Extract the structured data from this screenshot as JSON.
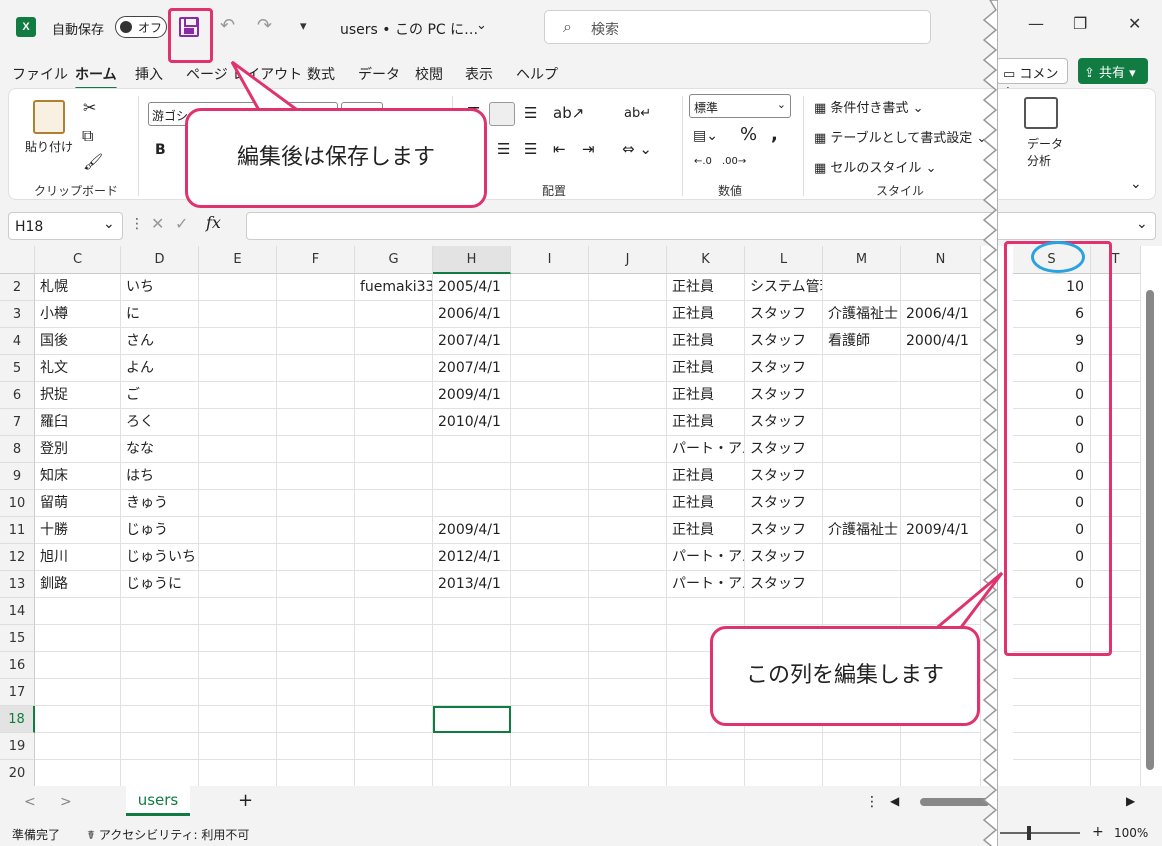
{
  "app": {
    "autosave_label": "自動保存",
    "autosave_state": "オフ",
    "doc_title": "users • この PC に…",
    "search_placeholder": "検索"
  },
  "ribbon_tabs": [
    "ファイル",
    "ホーム",
    "挿入",
    "ページ レイアウト",
    "数式",
    "データ",
    "校閲",
    "表示",
    "ヘルプ"
  ],
  "ribbon_right": {
    "comment": "コメント",
    "share": "共有"
  },
  "ribbon": {
    "paste": "貼り付け",
    "clipboard": "クリップボード",
    "font_name": "游ゴシック",
    "bold": "B",
    "alignment": "配置",
    "number_format": "標準",
    "number": "数値",
    "cond_format": "条件付き書式",
    "table_format": "テーブルとして書式設定",
    "cell_style": "セルのスタイル",
    "style": "スタイル",
    "data_analysis_1": "データ",
    "data_analysis_2": "分析"
  },
  "callouts": {
    "save": "編集後は保存します",
    "column": "この列を編集します"
  },
  "formula_bar": {
    "name_box": "H18",
    "fx": "fx"
  },
  "columns": [
    "C",
    "D",
    "E",
    "F",
    "G",
    "H",
    "I",
    "J",
    "K",
    "L",
    "M",
    "N",
    "S",
    "T"
  ],
  "rows": [
    {
      "n": "2",
      "C": "札幌",
      "D": "いち",
      "G": "fuemaki33",
      "H": "2005/4/1",
      "K": "正社員",
      "L": "システム管理者",
      "M": "",
      "N": "",
      "S": "10"
    },
    {
      "n": "3",
      "C": "小樽",
      "D": "に",
      "G": "",
      "H": "2006/4/1",
      "K": "正社員",
      "L": "スタッフ",
      "M": "介護福祉士",
      "N": "2006/4/1",
      "S": "6"
    },
    {
      "n": "4",
      "C": "国後",
      "D": "さん",
      "G": "",
      "H": "2007/4/1",
      "K": "正社員",
      "L": "スタッフ",
      "M": "看護師",
      "N": "2000/4/1",
      "S": "9"
    },
    {
      "n": "5",
      "C": "礼文",
      "D": "よん",
      "G": "",
      "H": "2007/4/1",
      "K": "正社員",
      "L": "スタッフ",
      "M": "",
      "N": "",
      "S": "0"
    },
    {
      "n": "6",
      "C": "択捉",
      "D": "ご",
      "G": "",
      "H": "2009/4/1",
      "K": "正社員",
      "L": "スタッフ",
      "M": "",
      "N": "",
      "S": "0"
    },
    {
      "n": "7",
      "C": "羅臼",
      "D": "ろく",
      "G": "",
      "H": "2010/4/1",
      "K": "正社員",
      "L": "スタッフ",
      "M": "",
      "N": "",
      "S": "0"
    },
    {
      "n": "8",
      "C": "登別",
      "D": "なな",
      "G": "",
      "H": "",
      "K": "パート・アルバイト",
      "L": "スタッフ",
      "M": "",
      "N": "",
      "S": "0"
    },
    {
      "n": "9",
      "C": "知床",
      "D": "はち",
      "G": "",
      "H": "",
      "K": "正社員",
      "L": "スタッフ",
      "M": "",
      "N": "",
      "S": "0"
    },
    {
      "n": "10",
      "C": "留萌",
      "D": "きゅう",
      "G": "",
      "H": "",
      "K": "正社員",
      "L": "スタッフ",
      "M": "",
      "N": "",
      "S": "0"
    },
    {
      "n": "11",
      "C": "十勝",
      "D": "じゅう",
      "G": "",
      "H": "2009/4/1",
      "K": "正社員",
      "L": "スタッフ",
      "M": "介護福祉士",
      "N": "2009/4/1",
      "S": "0"
    },
    {
      "n": "12",
      "C": "旭川",
      "D": "じゅういち",
      "G": "",
      "H": "2012/4/1",
      "K": "パート・アルバイト",
      "L": "スタッフ",
      "M": "",
      "N": "",
      "S": "0"
    },
    {
      "n": "13",
      "C": "釧路",
      "D": "じゅうに",
      "G": "",
      "H": "2013/4/1",
      "K": "パート・アルバイト",
      "L": "スタッフ",
      "M": "",
      "N": "",
      "S": "0"
    },
    {
      "n": "14"
    },
    {
      "n": "15"
    },
    {
      "n": "16"
    },
    {
      "n": "17"
    },
    {
      "n": "18"
    },
    {
      "n": "19"
    },
    {
      "n": "20"
    }
  ],
  "sheet_tab": "users",
  "status": {
    "ready": "準備完了",
    "accessibility": "アクセシビリティ: 利用不可",
    "zoom": "100%"
  },
  "colors": {
    "accent": "#107c41",
    "highlight": "#e0336e",
    "circle": "#29a3e0"
  }
}
